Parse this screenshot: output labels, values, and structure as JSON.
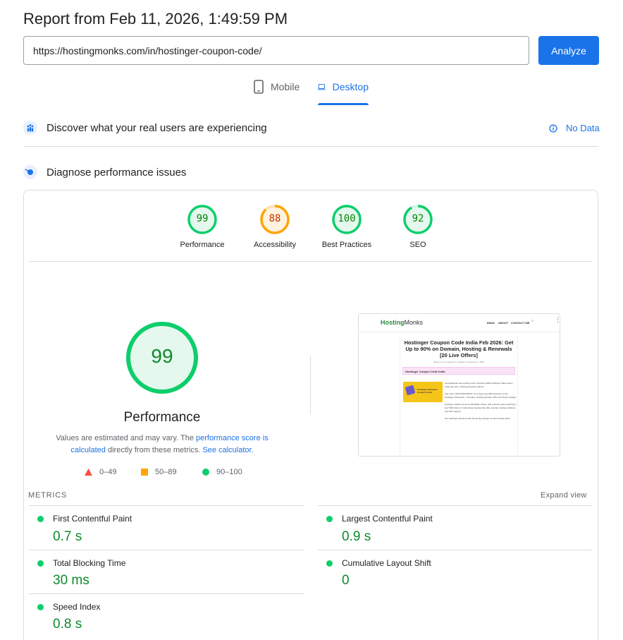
{
  "header": {
    "title": "Report from Feb 11, 2026, 1:49:59 PM",
    "url_value": "https://hostingmonks.com/in/hostinger-coupon-code/",
    "analyze_label": "Analyze"
  },
  "tabs": [
    {
      "label": "Mobile",
      "icon": "phone-icon",
      "active": false
    },
    {
      "label": "Desktop",
      "icon": "laptop-icon",
      "active": true
    }
  ],
  "field_data": {
    "title": "Discover what your real users are experiencing",
    "status": "No Data"
  },
  "diagnose": {
    "title": "Diagnose performance issues"
  },
  "categories": [
    {
      "label": "Performance",
      "score": "99",
      "status": "pass"
    },
    {
      "label": "Accessibility",
      "score": "88",
      "status": "average"
    },
    {
      "label": "Best Practices",
      "score": "100",
      "status": "pass"
    },
    {
      "label": "SEO",
      "score": "92",
      "status": "pass"
    }
  ],
  "main_score": {
    "score": "99",
    "label": "Performance",
    "desc_1": "Values are estimated and may vary. The ",
    "desc_link_1": "performance score is calculated",
    "desc_2": " directly from these metrics. ",
    "desc_link_2": "See calculator."
  },
  "legend": [
    {
      "range": "0–49",
      "shape": "triangle",
      "color": "#ff4e42"
    },
    {
      "range": "50–89",
      "shape": "square",
      "color": "#ffa400"
    },
    {
      "range": "90–100",
      "shape": "circle",
      "color": "#0cce6b"
    }
  ],
  "screenshot": {
    "logo_a": "Hosting",
    "logo_b": "Monks",
    "nav": [
      "INDIA",
      "ABOUT",
      "CONTACT ME"
    ],
    "heading": "Hostinger Coupon Code India Feb 2026: Get Up to 90% on Domain, Hosting & Renewals [20 Live Offers]",
    "byline": "Written by Anil Agarwal  |  Updated on February 2, 2026",
    "toc_label": "Hostinger Coupon Code India",
    "promo_label": "Hostinger Exclusive Coupon Codes",
    "para_1": "HostingMonks has exciting news: February 2026 Hostinger India coupon codes are here, offering 20 active options.",
    "para_2": "Use code \"HOSTINGMONKS\" for a huge upto 90% discount on ALL Hostinger India plans – Domains, Hosting (shared, VPS, and Cloud hosting).",
    "para_3": "Hostinger stands out as an affordable choice, with premium plans starting at just ₹116.10/mo in India. Enjoy freebies like SSL, domain, hosting, backups, and 24/7 support.",
    "para_4": "Our Hostinger discount code brings big savings on their hosting plans."
  },
  "metrics": {
    "section_label": "METRICS",
    "expand_label": "Expand view",
    "items": [
      {
        "name": "First Contentful Paint",
        "value": "0.7 s"
      },
      {
        "name": "Largest Contentful Paint",
        "value": "0.9 s"
      },
      {
        "name": "Total Blocking Time",
        "value": "30 ms"
      },
      {
        "name": "Cumulative Layout Shift",
        "value": "0"
      },
      {
        "name": "Speed Index",
        "value": "0.8 s"
      }
    ]
  },
  "colors": {
    "pass": "#0cce6b",
    "pass_text": "#008800",
    "average": "#ffa400",
    "average_text": "#c33300",
    "fail": "#ff4e42",
    "accent": "#1a73e8"
  }
}
